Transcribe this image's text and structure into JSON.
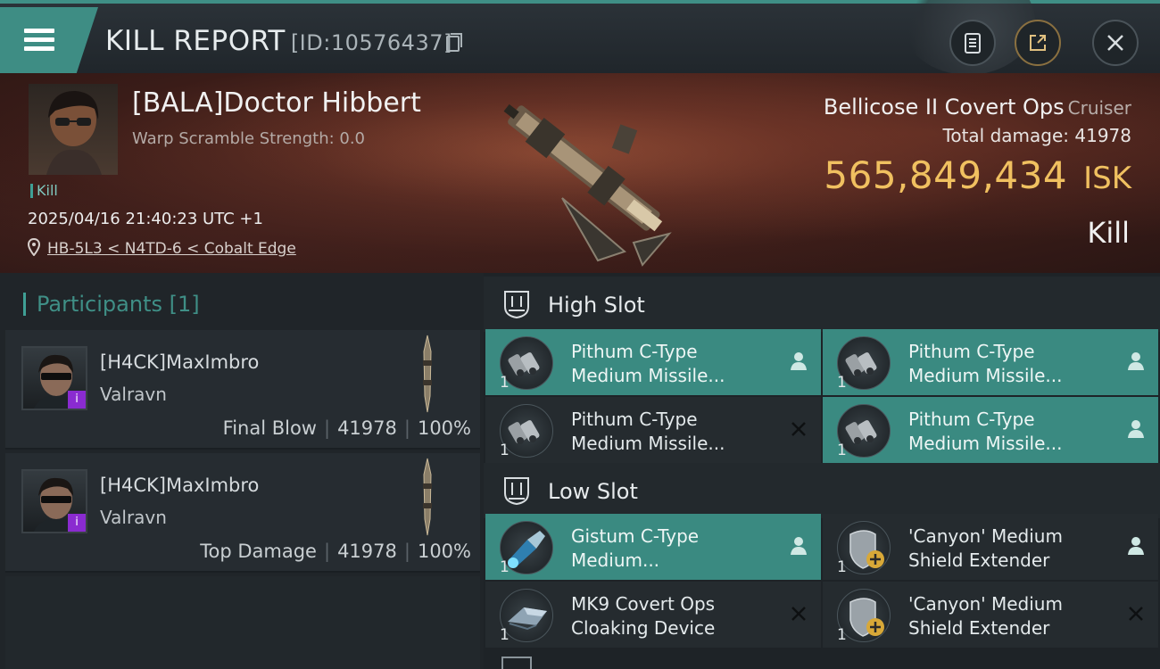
{
  "header": {
    "title": "KILL REPORT",
    "id_text": "[ID:10576437]"
  },
  "victim": {
    "name": "[BALA]Doctor Hibbert",
    "warp_text": "Warp Scramble Strength: 0.0",
    "tag": "Kill",
    "datetime": "2025/04/16 21:40:23 UTC +1",
    "location": "HB-5L3 < N4TD-6 < Cobalt Edge"
  },
  "ship": {
    "name": "Bellicose II Covert Ops",
    "class": "Cruiser",
    "total_damage_label": "Total damage:",
    "total_damage": "41978",
    "isk_value": "565,849,434",
    "isk_unit": "ISK",
    "result": "Kill"
  },
  "participants": {
    "header": "Participants [1]",
    "rows": [
      {
        "name": "[H4CK]MaxImbro",
        "ship": "Valravn",
        "role": "Final Blow",
        "damage": "41978",
        "percent": "100%"
      },
      {
        "name": "[H4CK]MaxImbro",
        "ship": "Valravn",
        "role": "Top Damage",
        "damage": "41978",
        "percent": "100%"
      }
    ]
  },
  "fitting": {
    "high_slot": {
      "label": "High Slot",
      "modules": [
        {
          "line1": "Pithum C-Type",
          "line2": "Medium Missile...",
          "qty": "1",
          "state": "dropped"
        },
        {
          "line1": "Pithum C-Type",
          "line2": "Medium Missile...",
          "qty": "1",
          "state": "dropped"
        },
        {
          "line1": "Pithum C-Type",
          "line2": "Medium Missile...",
          "qty": "1",
          "state": "destroyed"
        },
        {
          "line1": "Pithum C-Type",
          "line2": "Medium Missile...",
          "qty": "1",
          "state": "dropped"
        }
      ]
    },
    "low_slot": {
      "label": "Low Slot",
      "modules": [
        {
          "line1": "Gistum C-Type",
          "line2": "Medium...",
          "qty": "1",
          "state": "dropped"
        },
        {
          "line1": "'Canyon' Medium",
          "line2": "Shield Extender",
          "qty": "1",
          "state": "dropped"
        },
        {
          "line1": "MK9 Covert Ops",
          "line2": "Cloaking Device",
          "qty": "1",
          "state": "destroyed"
        },
        {
          "line1": "'Canyon' Medium",
          "line2": "Shield Extender",
          "qty": "1",
          "state": "destroyed"
        }
      ]
    }
  },
  "colors": {
    "accent": "#3f8f86",
    "isk": "#f0c060",
    "active_module": "#3a8a81"
  }
}
